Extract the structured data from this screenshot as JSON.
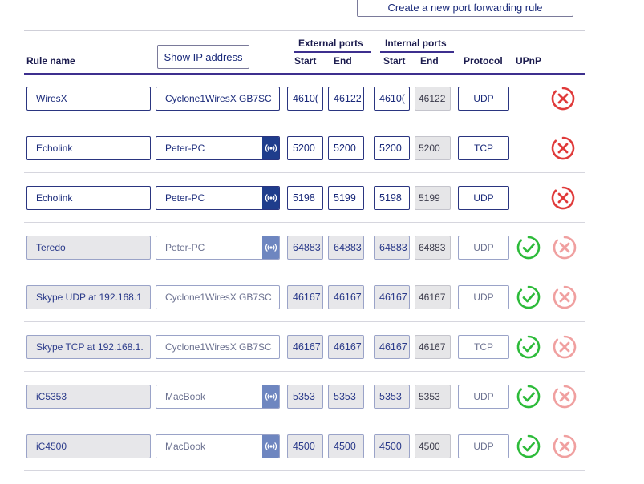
{
  "top": {
    "create_rule_label": "Create a new port forwarding rule"
  },
  "header": {
    "rule_name": "Rule name",
    "show_ip_label": "Show IP address",
    "external_ports": "External ports",
    "internal_ports": "Internal ports",
    "start": "Start",
    "end": "End",
    "protocol": "Protocol",
    "upnp": "UPnP"
  },
  "colors": {
    "accent": "#3d2f8e",
    "delete_red": "#e03a3a",
    "check_green": "#2dbb3a"
  },
  "rules": [
    {
      "name": "WiresX",
      "device": "Cyclone1WiresX GB7SC",
      "device_icon": false,
      "ext_start": "4610(",
      "ext_end": "46122",
      "int_start": "4610(",
      "int_end": "46122",
      "protocol": "UDP",
      "upnp": false
    },
    {
      "name": "Echolink",
      "device": "Peter-PC",
      "device_icon": true,
      "ext_start": "5200",
      "ext_end": "5200",
      "int_start": "5200",
      "int_end": "5200",
      "protocol": "TCP",
      "upnp": false
    },
    {
      "name": "Echolink",
      "device": "Peter-PC",
      "device_icon": true,
      "ext_start": "5198",
      "ext_end": "5199",
      "int_start": "5198",
      "int_end": "5199",
      "protocol": "UDP",
      "upnp": false
    },
    {
      "name": "Teredo",
      "device": "Peter-PC",
      "device_icon": true,
      "ext_start": "64883",
      "ext_end": "64883",
      "int_start": "64883",
      "int_end": "64883",
      "protocol": "UDP",
      "upnp": true
    },
    {
      "name": "Skype UDP at 192.168.1",
      "device": "Cyclone1WiresX GB7SC",
      "device_icon": false,
      "ext_start": "46167",
      "ext_end": "46167",
      "int_start": "46167",
      "int_end": "46167",
      "protocol": "UDP",
      "upnp": true
    },
    {
      "name": "Skype TCP at 192.168.1.",
      "device": "Cyclone1WiresX GB7SC",
      "device_icon": false,
      "ext_start": "46167",
      "ext_end": "46167",
      "int_start": "46167",
      "int_end": "46167",
      "protocol": "TCP",
      "upnp": true
    },
    {
      "name": "iC5353",
      "device": "MacBook",
      "device_icon": true,
      "ext_start": "5353",
      "ext_end": "5353",
      "int_start": "5353",
      "int_end": "5353",
      "protocol": "UDP",
      "upnp": true
    },
    {
      "name": "iC4500",
      "device": "MacBook",
      "device_icon": true,
      "ext_start": "4500",
      "ext_end": "4500",
      "int_start": "4500",
      "int_end": "4500",
      "protocol": "UDP",
      "upnp": true
    }
  ]
}
